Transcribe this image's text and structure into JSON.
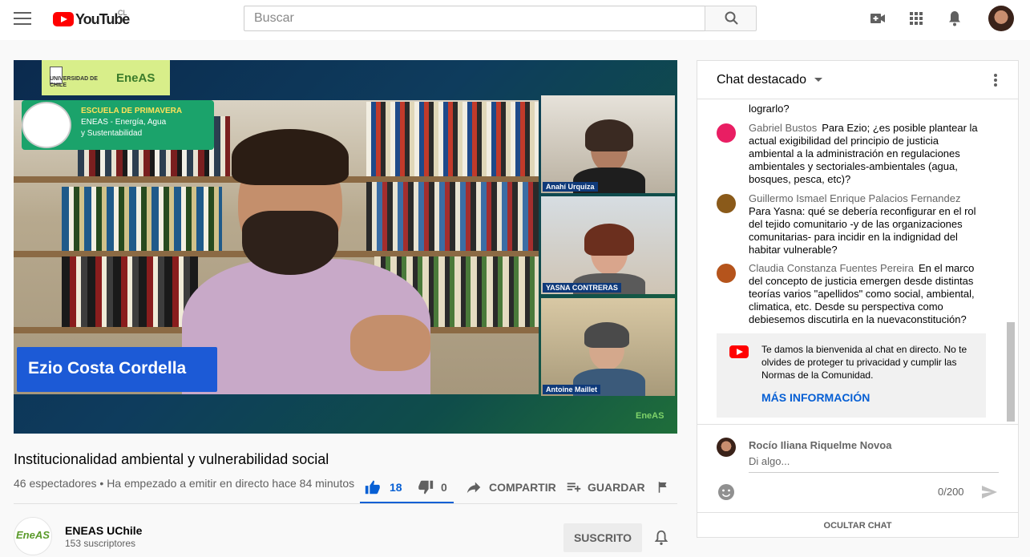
{
  "header": {
    "logo_text": "YouTube",
    "country_code": "CL",
    "search_placeholder": "Buscar"
  },
  "video": {
    "speaker_name": "Ezio Costa Cordella",
    "logo_bar_university": "UNIVERSIDAD DE CHILE",
    "logo_bar_brand": "EneAS",
    "school_label": "ESCUELA DE PRIMAVERA",
    "school_line2": "ENEAS - Energía, Agua",
    "school_line3": "y Sustentabilidad",
    "participants": [
      "Anahí Urquiza",
      "YASNA CONTRERAS",
      "Antoine Maillet"
    ],
    "corner_logo": "EneAS"
  },
  "info": {
    "title": "Institucionalidad ambiental y vulnerabilidad social",
    "meta": "46 espectadores • Ha empezado a emitir en directo hace 84 minutos",
    "likes": "18",
    "dislikes": "0",
    "share_label": "COMPARTIR",
    "save_label": "GUARDAR"
  },
  "channel": {
    "avatar_text": "EneAS",
    "name": "ENEAS UChile",
    "subs": "153 suscriptores",
    "subscribed_label": "SUSCRITO"
  },
  "chat": {
    "title": "Chat destacado",
    "truncated_text": "lograrlo?",
    "messages": [
      {
        "author": "Gabriel Bustos",
        "text": "Para Ezio; ¿es posible plantear la actual exigibilidad del principio de justicia ambiental a la administración en regulaciones ambientales y sectoriales-ambientales (agua, bosques, pesca, etc)?",
        "color": "#e91e63"
      },
      {
        "author": "Guillermo Ismael Enrique Palacios Fernandez",
        "text": "Para Yasna: qué se debería reconfigurar en el rol del tejido comunitario -y de las organizaciones comunitarias- para incidir en la indignidad del habitar vulnerable?",
        "color": "#8a5a1a"
      },
      {
        "author": "Claudia Constanza Fuentes Pereira",
        "text": "En el marco del concepto de justicia emergen desde distintas teorías varios \"apellidos\" como social, ambiental, climatica, etc. Desde su perspectiva como debiesemos discutirla en la nuevaconstitución?",
        "color": "#b5541c"
      }
    ],
    "welcome_text": "Te damos la bienvenida al chat en directo. No te olvides de proteger tu privacidad y cumplir las Normas de la Comunidad.",
    "welcome_more": "MÁS INFORMACIÓN",
    "current_user": "Rocío Iliana Riquelme Novoa",
    "input_placeholder": "Di algo...",
    "counter": "0/200",
    "hide_label": "OCULTAR CHAT"
  }
}
